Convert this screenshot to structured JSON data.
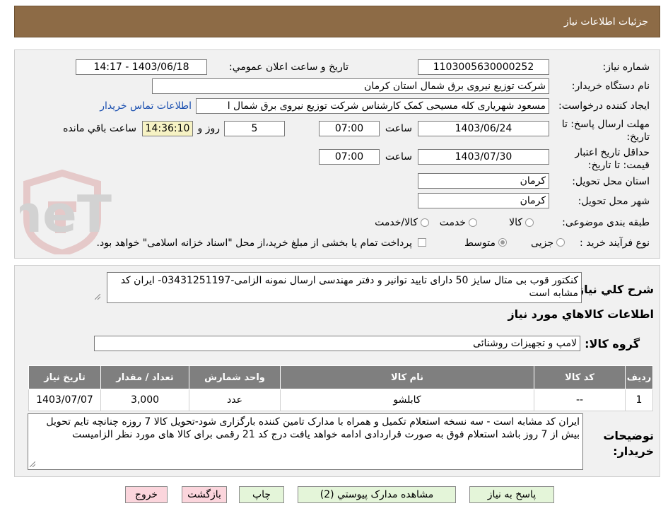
{
  "header": {
    "title": "جزئیات اطلاعات نیاز"
  },
  "form": {
    "need_number_label": "شماره نیاز:",
    "need_number": "1103005630000252",
    "announce_label": "تاریخ و ساعت اعلان عمومي:",
    "announce_value": "1403/06/18 - 14:17",
    "buyer_org_label": "نام دستگاه خریدار:",
    "buyer_org": "شرکت توزیع نیروی برق شمال استان کرمان",
    "creator_label": "ایجاد کننده درخواست:",
    "creator": "مسعود شهریاری کله مسیحی کمک کارشناس شرکت توزیع نیروی برق شمال ا",
    "contact_link": "اطلاعات تماس خریدار",
    "reply_deadline_label": "مهلت ارسال پاسخ: تا تاریخ:",
    "reply_date": "1403/06/24",
    "time_label": "ساعت",
    "reply_time": "07:00",
    "days_value": "5",
    "days_label": "روز و",
    "remaining_time": "14:36:10",
    "remaining_label": "ساعت باقي مانده",
    "price_validity_label": "حداقل تاریخ اعتبار قیمت: تا تاریخ:",
    "validity_date": "1403/07/30",
    "validity_time": "07:00",
    "province_label": "استان محل تحویل:",
    "province": "کرمان",
    "city_label": "شهر محل تحویل:",
    "city": "کرمان",
    "category_label": "طبقه بندی موضوعی:",
    "category_options": [
      "کالا",
      "خدمت",
      "کالا/خدمت"
    ],
    "process_label": "نوع فرآیند خرید :",
    "process_options": [
      "جزیی",
      "متوسط"
    ],
    "payment_note": "پرداخت تمام یا بخشی از مبلغ خرید،از محل \"اسناد خزانه اسلامی\" خواهد بود."
  },
  "summary": {
    "general_desc_label": "شرح کلي نیاز:",
    "general_desc": "کنکتور قوب بی متال سایز 50 دارای تایید توانیر و دفتر مهندسی ارسال نمونه الزامی-03431251197- ایران کد مشابه است",
    "goods_info_title": "اطلاعات کالاهاي مورد نیاز",
    "goods_group_label": "گروه کالا:",
    "goods_group": "لامپ و تجهیزات روشنائی",
    "table": {
      "headers": [
        "ردیف",
        "کد کالا",
        "نام کالا",
        "واحد شمارش",
        "تعداد / مقدار",
        "تاریخ نیاز"
      ],
      "rows": [
        [
          "1",
          "--",
          "کابلشو",
          "عدد",
          "3,000",
          "1403/07/07"
        ]
      ]
    },
    "buyer_notes_label": "توضیحات خریدار:",
    "buyer_notes": "ایران کد مشابه است - سه نسخه استعلام تکمیل و همراه با مدارک تامین کننده بارگزاری شود-تحویل کالا 7 روزه چنانچه تایم تحویل بیش از 7 روز باشد استعلام فوق به صورت قراردادی ادامه خواهد یافت  درج کد 21 رقمی برای کالا های مورد نظر الزامیست"
  },
  "buttons": {
    "reply": "پاسخ به نیاز",
    "attachments": "مشاهده مدارک پیوستي (2)",
    "print": "چاپ",
    "back": "بازگشت",
    "exit": "خروج"
  },
  "watermark": {
    "text": "AriaTender.neT"
  },
  "colors": {
    "header_bg": "#8d6b46",
    "table_header_bg": "#7f7f7f",
    "green_button": "#e4f5d9",
    "pink_button": "#fbd5dc",
    "remaining_bg": "#f6f2c4",
    "link": "#1a4fb0"
  }
}
